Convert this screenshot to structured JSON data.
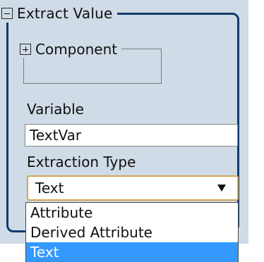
{
  "group": {
    "title": "Extract Value",
    "toggle_icon": "minus-box-icon"
  },
  "component": {
    "title": "Component",
    "toggle_icon": "plus-box-icon"
  },
  "variable": {
    "label": "Variable",
    "value": "TextVar"
  },
  "extraction_type": {
    "label": "Extraction Type",
    "selected": "Text",
    "options": [
      "Attribute",
      "Derived Attribute",
      "Text"
    ]
  },
  "colors": {
    "panel_bg": "#cfdbe6",
    "border_dark": "#123a6f",
    "select_border": "#d6a552",
    "selected_option_bg": "#3399ff"
  }
}
